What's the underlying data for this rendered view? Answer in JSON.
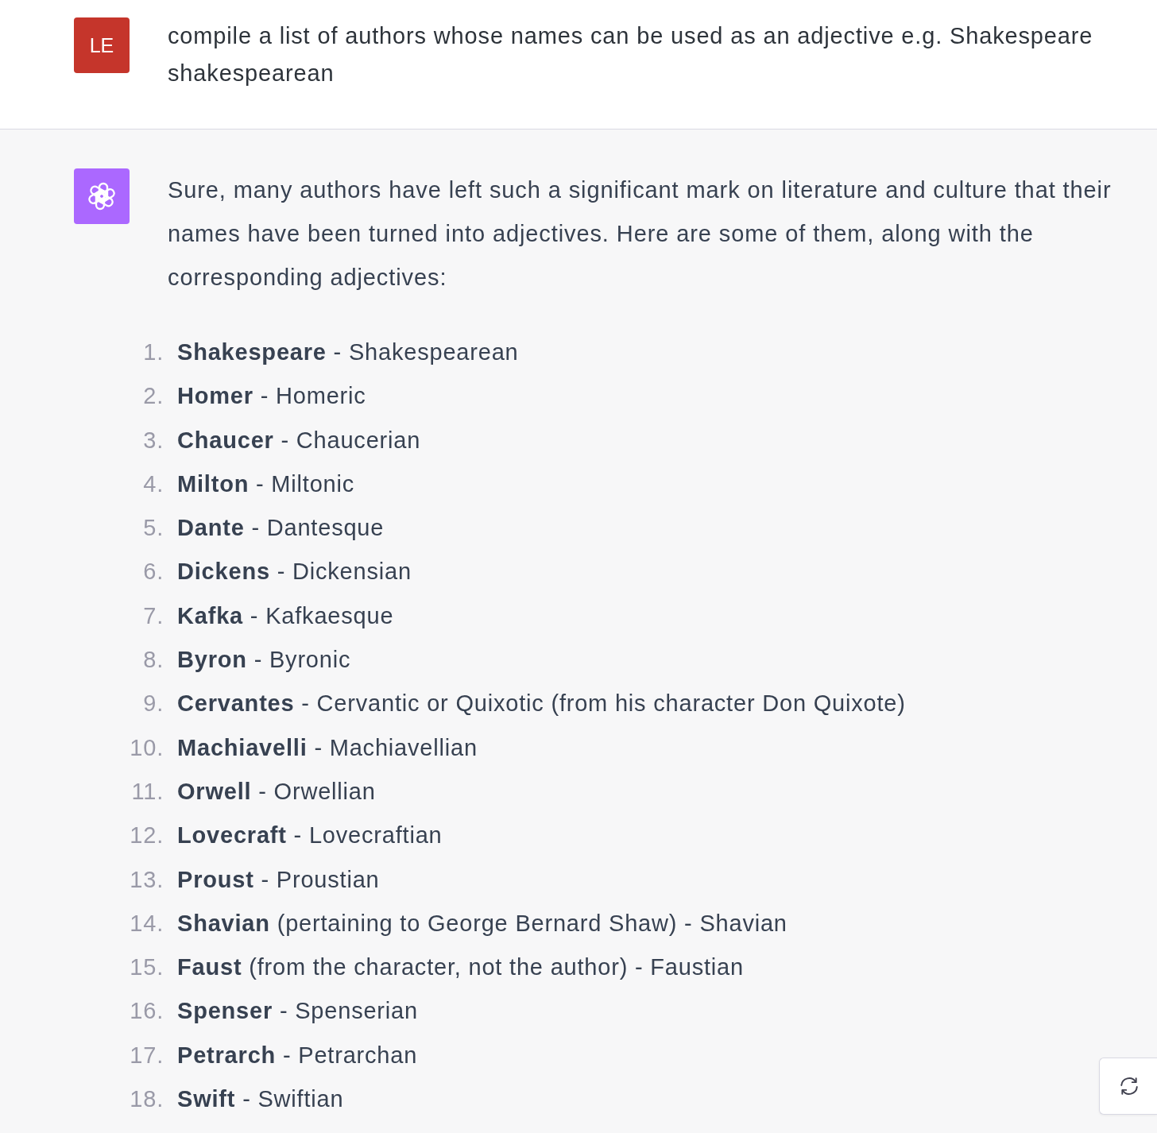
{
  "messages": [
    {
      "kind": "user",
      "avatar": "LE",
      "text": "compile a list of authors whose names can be used as an adjective e.g. Shakespeare shakespearean"
    },
    {
      "kind": "assistant",
      "text": "Sure, many authors have left such a significant mark on literature and culture that their names have been turned into adjectives. Here are some of them, along with the corresponding adjectives:",
      "list": [
        {
          "number": "1.",
          "text": "**Shakespeare** - Shakespearean"
        },
        {
          "number": "2.",
          "text": "**Homer** - Homeric"
        },
        {
          "number": "3.",
          "text": "**Chaucer** - Chaucerian"
        },
        {
          "number": "4.",
          "text": "**Milton** - Miltonic"
        },
        {
          "number": "5.",
          "text": "**Dante** - Dantesque"
        },
        {
          "number": "6.",
          "text": "**Dickens** - Dickensian"
        },
        {
          "number": "7.",
          "text": "**Kafka** - Kafkaesque"
        },
        {
          "number": "8.",
          "text": "**Byron** - Byronic"
        },
        {
          "number": "9.",
          "text": "**Cervantes** - Cervantic or Quixotic (from his character Don Quixote)"
        },
        {
          "number": "10.",
          "text": "**Machiavelli** - Machiavellian"
        },
        {
          "number": "11.",
          "text": "**Orwell** - Orwellian"
        },
        {
          "number": "12.",
          "text": "**Lovecraft** - Lovecraftian"
        },
        {
          "number": "13.",
          "text": "**Proust** - Proustian"
        },
        {
          "number": "14.",
          "text": "**Shavian** (pertaining to George Bernard Shaw) - Shavian"
        },
        {
          "number": "15.",
          "text": "**Faust** (from the character, not the author) - Faustian"
        },
        {
          "number": "16.",
          "text": "**Spenser** - Spenserian"
        },
        {
          "number": "17.",
          "text": "**Petrarch** - Petrarchan"
        },
        {
          "number": "18.",
          "text": "**Swift** - Swiftian"
        }
      ]
    }
  ]
}
